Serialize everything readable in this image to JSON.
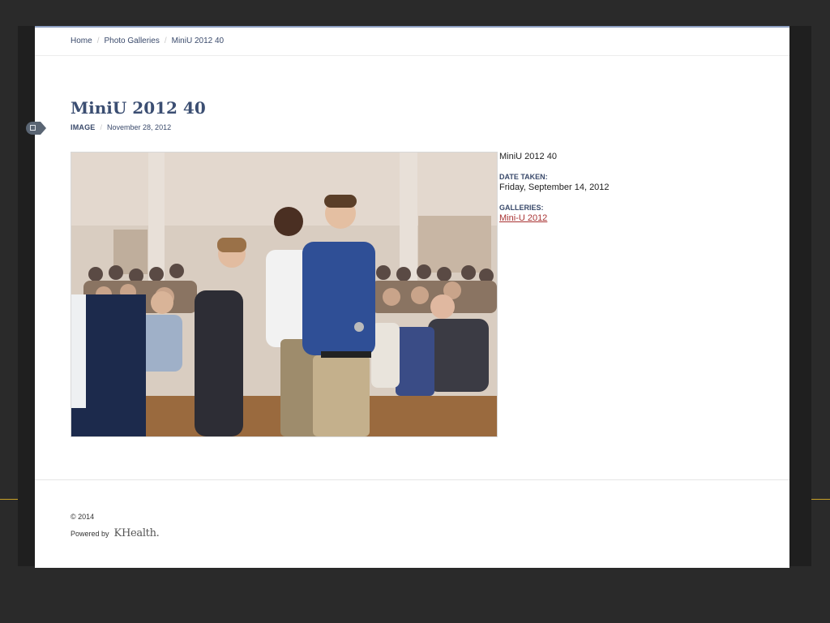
{
  "breadcrumb": {
    "items": [
      "Home",
      "Photo Galleries",
      "MiniU 2012 40"
    ],
    "separator": "/"
  },
  "page": {
    "title": "MiniU 2012 40",
    "meta_type": "IMAGE",
    "meta_separator": "/",
    "meta_date": "November 28, 2012"
  },
  "photo": {
    "icon": "photo-image",
    "caption_title": "MiniU 2012 40"
  },
  "details": {
    "date_taken_label": "DATE TAKEN:",
    "date_taken_value": "Friday, September 14, 2012",
    "galleries_label": "GALLERIES:",
    "gallery_link": "Mini-U 2012"
  },
  "footer": {
    "copyright": "© 2014",
    "powered_by": "Powered by",
    "brand": "KHealth."
  },
  "colors": {
    "background": "#2a2a2a",
    "page": "#ffffff",
    "title": "#3b4e72",
    "link": "#a83232",
    "accent": "#c9a227"
  }
}
